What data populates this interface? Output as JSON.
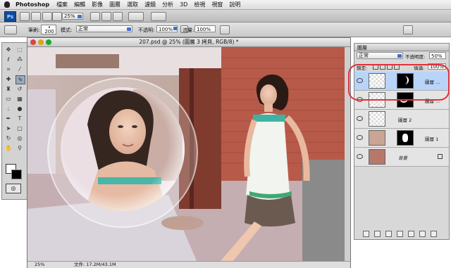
{
  "menubar": {
    "app_name": "Photoshop",
    "items": [
      "檔案",
      "編輯",
      "影像",
      "圖層",
      "選取",
      "濾鏡",
      "分析",
      "3D",
      "檢視",
      "視窗",
      "說明"
    ]
  },
  "appbar": {
    "badge": "Ps",
    "zoom": "25%"
  },
  "options": {
    "brush_label": "筆刷:",
    "brush_size": "200",
    "mode_label": "模式:",
    "mode_value": "正常",
    "opacity_label": "不透明:",
    "opacity_value": "100%",
    "flow_label": "流量:",
    "flow_value": "100%"
  },
  "document": {
    "title": "207.psd @ 25% (圖層 3 拷貝, RGB/8) *",
    "zoom": "25%",
    "file_info": "文件: 17.2M/43.1M"
  },
  "layers_panel": {
    "tab_label": "圖層",
    "blend_mode": "正常",
    "opacity_label": "不透明度:",
    "opacity_value": "50%",
    "lock_label": "鎖定:",
    "fill_label": "填滿:",
    "fill_value": "100%",
    "layers": [
      {
        "name": "圖層 ...",
        "selected": true
      },
      {
        "name": "圖層 ...",
        "selected": false
      },
      {
        "name": "圖層 2",
        "selected": false
      },
      {
        "name": "圖層 1",
        "selected": false
      },
      {
        "name": "背景",
        "selected": false
      }
    ]
  },
  "colors": {
    "highlight_ring": "#e2313b",
    "selected_layer": "#b8d4f8"
  }
}
